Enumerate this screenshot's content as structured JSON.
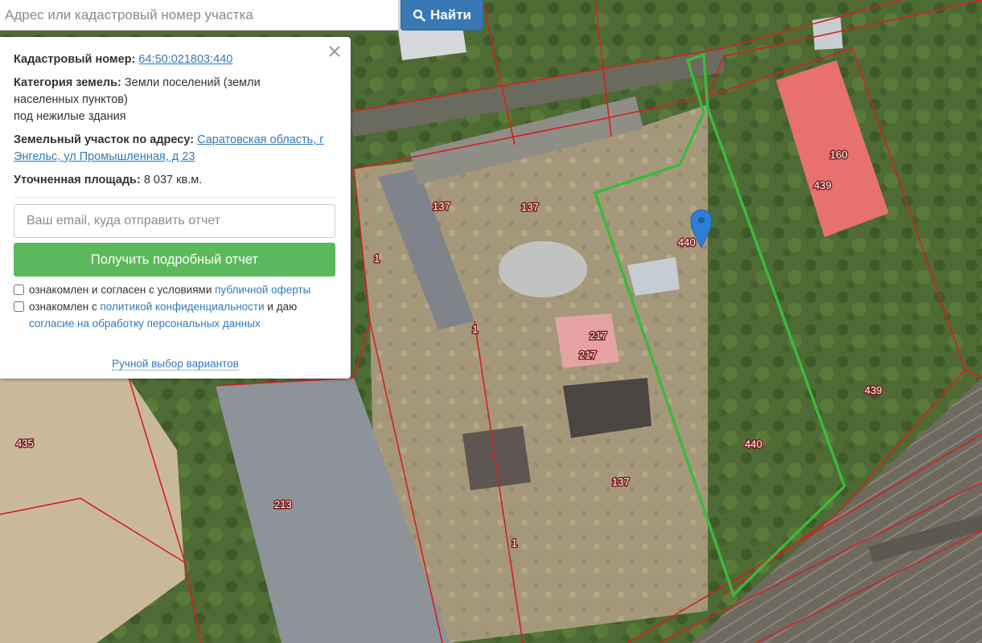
{
  "search": {
    "placeholder": "Адрес или кадастровый номер участка",
    "button_label": "Найти",
    "button_icon": "search-icon"
  },
  "info": {
    "cadastral_label": "Кадастровый номер:",
    "cadastral_value": "64:50:021803:440",
    "category_label": "Категория земель:",
    "category_value_line1": "Земли поселений (земли",
    "category_value_line2": "населенных пунктов)",
    "category_value_line3": "под нежилые здания",
    "address_label": "Земельный участок по адресу:",
    "address_value_line1": "Саратовская область, г",
    "address_value_line2": "Энгельс, ул Промышленная, д 23",
    "area_label": "Уточненная площадь:",
    "area_value": "8 037 кв.м.",
    "email_placeholder": "Ваш email, куда отправить отчет",
    "report_button": "Получить подробный отчет",
    "check1_text": "ознакомлен и согласен с условиями",
    "check1_link": "публичной оферты",
    "check2_text_a": "ознакомлен с",
    "check2_link_a": "политикой конфиденциальности",
    "check2_text_b": "и даю",
    "check2_link_b": "согласие на обработку персональных данных",
    "manual_link": "Ручной выбор вариантов",
    "close_icon": "close-icon"
  },
  "map": {
    "labels": [
      "440",
      "440",
      "439",
      "439",
      "160",
      "137",
      "137",
      "137",
      "217",
      "217",
      "213",
      "435",
      "1",
      "1",
      "1"
    ],
    "colors": {
      "selected_parcel": "#3db83d",
      "parcel_border": "#d42020",
      "highlight_building": "#e86a6a",
      "marker": "#2d7fd3"
    },
    "marker_icon": "map-marker-icon"
  }
}
